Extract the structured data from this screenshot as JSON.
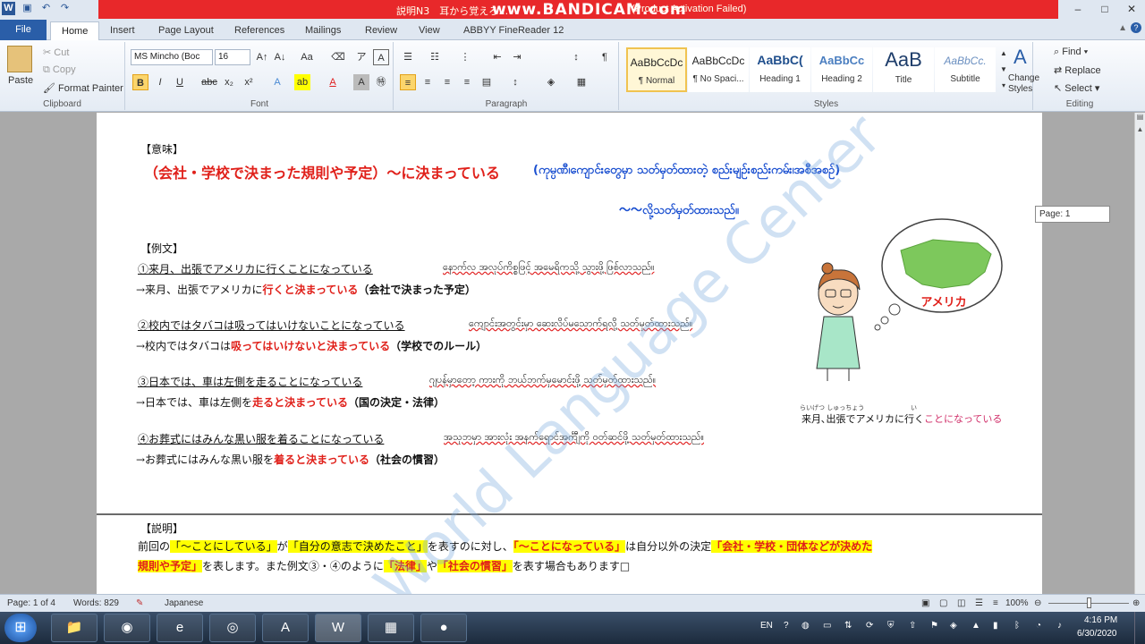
{
  "titlebar": {
    "doc_title": "説明N3　耳から覚えろ…",
    "recorder_brand": "www.BANDICAM.com",
    "activation_note": "(Product Activation Failed)",
    "controls": [
      "–",
      "□",
      "✕"
    ]
  },
  "tabs": {
    "file": "File",
    "items": [
      "Home",
      "Insert",
      "Page Layout",
      "References",
      "Mailings",
      "Review",
      "View",
      "ABBYY FineReader 12"
    ]
  },
  "ribbon": {
    "clipboard": {
      "paste": "Paste",
      "cut": "Cut",
      "copy": "Copy",
      "format_painter": "Format Painter",
      "label": "Clipboard"
    },
    "font": {
      "name": "MS Mincho (Boc",
      "size": "16",
      "label": "Font"
    },
    "paragraph": {
      "label": "Paragraph"
    },
    "styles": {
      "label": "Styles",
      "items": [
        {
          "preview": "AaBbCcDc",
          "name": "¶ Normal"
        },
        {
          "preview": "AaBbCcDc",
          "name": "¶ No Spaci..."
        },
        {
          "preview": "AaBbC(",
          "name": "Heading 1"
        },
        {
          "preview": "AaBbCc",
          "name": "Heading 2"
        },
        {
          "preview": "AaB",
          "name": "Title"
        },
        {
          "preview": "AaBbCc.",
          "name": "Subtitle"
        }
      ],
      "change_styles": "Change Styles"
    },
    "editing": {
      "find": "Find",
      "replace": "Replace",
      "select": "Select",
      "label": "Editing"
    }
  },
  "document": {
    "meaning_head": "【意味】",
    "meaning_jp": "（会社・学校で決まった規則や予定）～に決まっている",
    "meaning_my": "(ကုမ္ပဏီ၊ကျောင်းတွေမှာ သတ်မှတ်ထားတဲ့ စည်းမျဉ်းစည်းကမ်း၊အစီအစဉ်)",
    "meaning_my2": "～～လို့သတ်မှတ်ထားသည်။",
    "examples_head": "【例文】",
    "examples": [
      {
        "jp1": "①来月、出張でアメリカに行くことになっている",
        "my": "နောက်လ အလုပ်ကိစ္စဖြင့် အမေရိကသို့ သွားဖို့ဖြစ်လာသည်။",
        "arrow": "→来月、出張でアメリカに",
        "bold": "行くと決まっている",
        "note": "（会社で決まった予定）"
      },
      {
        "jp1": "②校内ではタバコは吸ってはいけないことになっている",
        "my": "ကျောင်းအတွင်းမှာ ဆေးလိပ်မသောက်ရလို့ သတ်မှတ်ထားသည်။",
        "arrow": "→校内ではタバコは",
        "bold": "吸ってはいけないと決まっている",
        "note": "（学校でのルール）"
      },
      {
        "jp1": "③日本では、車は左側を走ることになっている",
        "my": "ဂျပန်မှာတော့ ကားကို ဘယ်ဘက်မှမောင်းဖို့ သတ်မှတ်ထားသည်။",
        "arrow": "→日本では、車は左側を",
        "bold": "走ると決まっている",
        "note": "（国の決定・法律）"
      },
      {
        "jp1": "④お葬式にはみんな黒い服を着ることになっている",
        "my": "အသုဘမှာ အားလုံး အနက်ရောင်အင်္ကျီကို ဝတ်ဆင်ဖို့ သတ်မှတ်ထားသည်။",
        "arrow": "→お葬式にはみんな黒い服を",
        "bold": "着ると決まっている",
        "note": "（社会の慣習）"
      }
    ],
    "illustration": {
      "map_label": "アメリカ",
      "ruby1": "らいげつ しゅっちょう",
      "ruby2": "い",
      "caption_plain": "来月､出張でアメリカに行く",
      "caption_colored": "ことになっている"
    },
    "watermark": "World Language Center",
    "explain_head": "【説明】",
    "explain_l1a": "前回の",
    "explain_l1b": "「～ことにしている」",
    "explain_l1c": "が",
    "explain_l1d": "「自分の意志で決めたこと」",
    "explain_l1e": "を表すのに対し、",
    "explain_l1f": "「～ことになっている」",
    "explain_l1g": "は自分以外の決定",
    "explain_l1h": "「会社・学校・団体などが決めた",
    "explain_l2a": "規則や予定」",
    "explain_l2b": "を表します。また例文③・④のように",
    "explain_l2c": "「法律」",
    "explain_l2d": "や",
    "explain_l2e": "「社会の慣習」",
    "explain_l2f": "を表す場合もあります□"
  },
  "page_tip": "Page: 1",
  "statusbar": {
    "page": "Page: 1 of 4",
    "words": "Words: 829",
    "language": "Japanese",
    "zoom": "100%"
  },
  "taskbar": {
    "language": "EN",
    "time": "4:16 PM",
    "date": "6/30/2020"
  }
}
